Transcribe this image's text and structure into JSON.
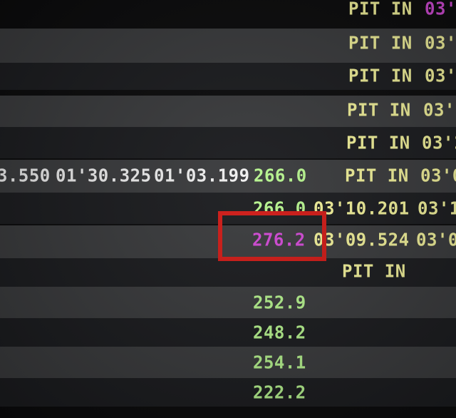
{
  "timing_rows": [
    {
      "sector_time": "",
      "lap_a": "",
      "lap_b": "",
      "speed": "",
      "col_a": "PIT IN",
      "col_a_tail": "03'",
      "col_b": ""
    },
    {
      "sector_time": "",
      "lap_a": "",
      "lap_b": "",
      "speed": "",
      "col_a": "PIT IN",
      "col_a_tail": "03'0",
      "col_b": ""
    },
    {
      "sector_time": "",
      "lap_a": "",
      "lap_b": "",
      "speed": "",
      "col_a": "PIT IN",
      "col_a_tail": "03'0",
      "col_b": ""
    },
    {
      "sector_time": "",
      "lap_a": "",
      "lap_b": "",
      "speed": "",
      "col_a": "PIT IN",
      "col_a_tail": "03'1",
      "col_b": ""
    },
    {
      "sector_time": "",
      "lap_a": "",
      "lap_b": "",
      "speed": "",
      "col_a": "PIT IN",
      "col_a_tail": "03'1",
      "col_b": ""
    },
    {
      "sector_time": "3.550",
      "lap_a": "01'30.325",
      "lap_b": "01'03.199",
      "speed": "266.0",
      "col_a": "PIT IN",
      "col_a_tail": "03'0",
      "col_b": ""
    },
    {
      "sector_time": "",
      "lap_a": "",
      "lap_b": "",
      "speed": "266.0",
      "col_a": "03'10.201",
      "col_a_tail": "",
      "col_b": "03'1"
    },
    {
      "sector_time": "",
      "lap_a": "",
      "lap_b": "",
      "speed": "276.2",
      "col_a": "03'09.524",
      "col_a_tail": "",
      "col_b": "03'0"
    },
    {
      "sector_time": "",
      "lap_a": "",
      "lap_b": "",
      "speed": "",
      "col_a": "PIT IN",
      "col_a_tail": "",
      "col_b": ""
    },
    {
      "sector_time": "",
      "lap_a": "",
      "lap_b": "",
      "speed": "252.9",
      "col_a": "",
      "col_a_tail": "",
      "col_b": ""
    },
    {
      "sector_time": "",
      "lap_a": "",
      "lap_b": "",
      "speed": "248.2",
      "col_a": "",
      "col_a_tail": "",
      "col_b": ""
    },
    {
      "sector_time": "",
      "lap_a": "",
      "lap_b": "",
      "speed": "254.1",
      "col_a": "",
      "col_a_tail": "",
      "col_b": ""
    },
    {
      "sector_time": "",
      "lap_a": "",
      "lap_b": "",
      "speed": "222.2",
      "col_a": "",
      "col_a_tail": "",
      "col_b": ""
    }
  ],
  "colors": {
    "row_light": "#3a3b3d",
    "row_dark": "#1b1c1f",
    "text_white": "#f1f1f1",
    "text_yellow": "#f3f29a",
    "text_green": "#b7f58f",
    "text_magenta": "#d24ad6",
    "highlight_red": "#d01a16"
  }
}
